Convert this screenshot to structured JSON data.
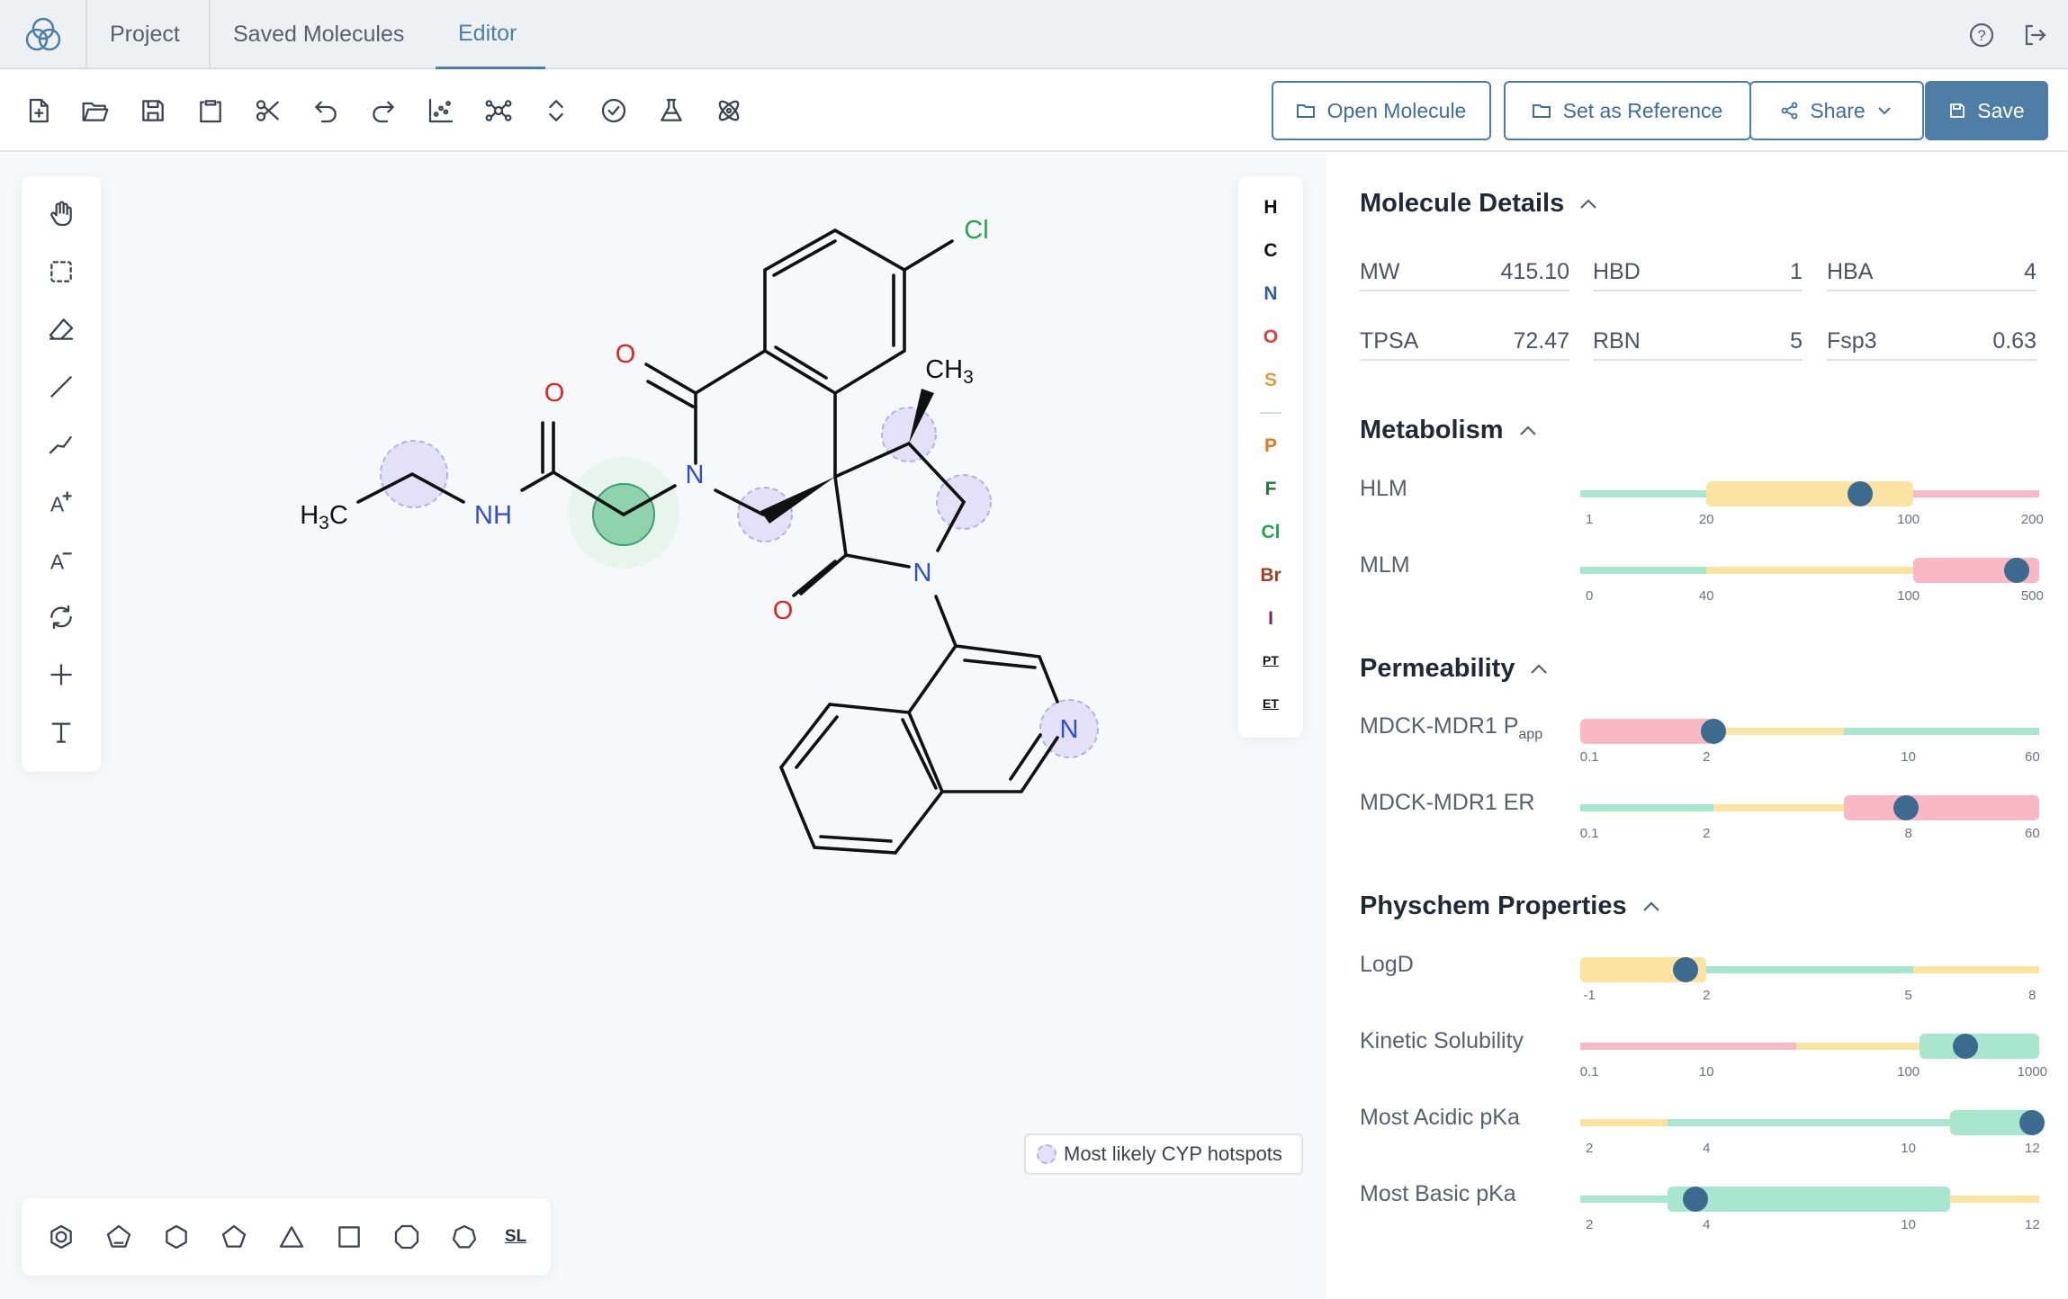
{
  "nav": {
    "tabs": [
      {
        "label": "Project"
      },
      {
        "label": "Saved Molecules"
      },
      {
        "label": "Editor"
      }
    ],
    "active_tab": "Editor"
  },
  "toolbar": {
    "icons": [
      "new-file-icon",
      "open-folder-icon",
      "save-disk-icon",
      "clipboard-icon",
      "scissors-icon",
      "undo-icon",
      "redo-icon",
      "scatter-plot-icon",
      "network-icon",
      "expand-collapse-icon",
      "check-circle-icon",
      "flask-icon",
      "atom-icon"
    ],
    "open_molecule": "Open Molecule",
    "set_reference": "Set as Reference",
    "share": "Share",
    "save": "Save"
  },
  "canvas": {
    "elements": [
      {
        "symbol": "H",
        "color": "#111111"
      },
      {
        "symbol": "C",
        "color": "#111111"
      },
      {
        "symbol": "N",
        "color": "#2f5f9a"
      },
      {
        "symbol": "O",
        "color": "#e0423a"
      },
      {
        "symbol": "S",
        "color": "#d9a03a"
      },
      {
        "symbol": "P",
        "color": "#e07a1f"
      },
      {
        "symbol": "F",
        "color": "#1f7a3a"
      },
      {
        "symbol": "Cl",
        "color": "#21a84a"
      },
      {
        "symbol": "Br",
        "color": "#a0421f"
      },
      {
        "symbol": "I",
        "color": "#7a1f6a"
      },
      {
        "symbol": "PT",
        "color": "#111111"
      },
      {
        "symbol": "ET",
        "color": "#111111"
      }
    ],
    "shape_last_label": "SL",
    "legend": "Most likely CYP hotspots",
    "atoms": {
      "o1": "O",
      "o2": "O",
      "o3": "O",
      "n_amide": "NH",
      "n_ring": "N",
      "n_pyr": "N",
      "n_iso": "N",
      "cl": "Cl",
      "ch3": "CH",
      "ch3_sub": "3",
      "h3c": "H",
      "h3c_sub": "3",
      "h3c_tail": "C"
    }
  },
  "panel": {
    "molecule_details": {
      "title": "Molecule Details",
      "props": [
        {
          "name": "MW",
          "value": "415.10"
        },
        {
          "name": "HBD",
          "value": "1"
        },
        {
          "name": "HBA",
          "value": "4"
        },
        {
          "name": "TPSA",
          "value": "72.47"
        },
        {
          "name": "RBN",
          "value": "5"
        },
        {
          "name": "Fsp3",
          "value": "0.63"
        }
      ]
    },
    "metabolism": {
      "title": "Metabolism",
      "rows": [
        {
          "label": "HLM",
          "ticks": [
            "1",
            "20",
            "100",
            "200"
          ],
          "value_fraction": 0.61
        },
        {
          "label": "MLM",
          "ticks": [
            "0",
            "40",
            "100",
            "500"
          ],
          "value_fraction": 0.95
        }
      ]
    },
    "permeability": {
      "title": "Permeability",
      "rows": [
        {
          "label": "MDCK-MDR1 P",
          "label_sub": "app",
          "ticks": [
            "0.1",
            "2",
            "10",
            "60"
          ],
          "value_fraction": 0.29
        },
        {
          "label": "MDCK-MDR1 ER",
          "ticks": [
            "0.1",
            "2",
            "8",
            "60"
          ],
          "value_fraction": 0.71
        }
      ]
    },
    "physchem": {
      "title": "Physchem Properties",
      "rows": [
        {
          "label": "LogD",
          "ticks": [
            "-1",
            "2",
            "5",
            "8"
          ],
          "value_fraction": 0.23
        },
        {
          "label": "Kinetic Solubility",
          "ticks": [
            "0.1",
            "10",
            "100",
            "1000"
          ],
          "value_fraction": 0.84
        },
        {
          "label": "Most Acidic pKa",
          "ticks": [
            "2",
            "4",
            "10",
            "12"
          ],
          "value_fraction": 0.985
        },
        {
          "label": "Most Basic pKa",
          "ticks": [
            "2",
            "4",
            "10",
            "12"
          ],
          "value_fraction": 0.25
        }
      ]
    },
    "colors": {
      "green": "#a8e6cf",
      "yellow": "#fbe3a2",
      "red": "#f9b8c3",
      "knob": "#3d6a8f"
    }
  }
}
